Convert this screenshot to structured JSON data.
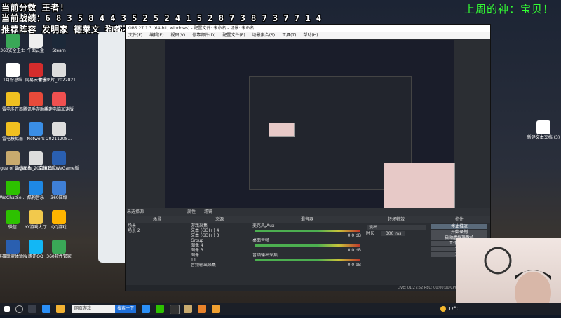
{
  "overlay": {
    "line1": "当前分数 王者!",
    "line2": "当前战绩：6 8 3 5 8 4 4 3 5 2 5 2 4 1 5 2 8 7 3 8 7 3 7 7 1 4",
    "line3": "推荐阵容 发明家 德莱文 狗都不玩男刀 狐狸 德莱文！",
    "god": "上周的神：宝贝！"
  },
  "desktop_icons": [
    {
      "label": "360安全卫士",
      "color": "#3aa757"
    },
    {
      "label": "牛面云盘",
      "color": "#eeeeee"
    },
    {
      "label": "Steam",
      "color": "#1b2838"
    },
    {
      "label": "1月份总结",
      "color": "#ffffff"
    },
    {
      "label": "网易云音乐",
      "color": "#d42c2c"
    },
    {
      "label": "微信图片_2022021...",
      "color": "#dddddd"
    },
    {
      "label": "雷电多开器",
      "color": "#f0c020"
    },
    {
      "label": "腾讯手游助手",
      "color": "#e84a3a"
    },
    {
      "label": "新建电脑加速版",
      "color": "#f05050"
    },
    {
      "label": "雷电模拟器",
      "color": "#f0c020"
    },
    {
      "label": "Network",
      "color": "#3a8ee6"
    },
    {
      "label": "20211208...",
      "color": "#dddddd"
    },
    {
      "label": "League of Legends",
      "color": "#c8aa6e"
    },
    {
      "label": "微信图片_2022021...",
      "color": "#dddddd"
    },
    {
      "label": "英雄联盟WeGame版",
      "color": "#2a5fb0"
    },
    {
      "label": "WeChatSe...",
      "color": "#2dc100"
    },
    {
      "label": "酷狗音乐",
      "color": "#1e88e5"
    },
    {
      "label": "360压缩",
      "color": "#3f7fd6"
    },
    {
      "label": "微信",
      "color": "#2dc100"
    },
    {
      "label": "YY游戏大厅",
      "color": "#f2c94c"
    },
    {
      "label": "QQ游戏",
      "color": "#ffb400"
    },
    {
      "label": "英雄联盟体验服",
      "color": "#2a5fb0"
    },
    {
      "label": "腾讯QQ",
      "color": "#12b7f5"
    },
    {
      "label": "360软件管家",
      "color": "#3aa757"
    }
  ],
  "right_icons": [
    {
      "label": "新建文本文档 (3)",
      "color": "#ffffff"
    }
  ],
  "obs": {
    "title": "OBS 27.1.3 (64-bit, windows) - 配置文件: 未命名 - 场景: 未命名",
    "menu": [
      "文件(F)",
      "编辑(E)",
      "视图(V)",
      "停靠部件(D)",
      "配置文件(P)",
      "场景集合(S)",
      "工具(T)",
      "帮助(H)"
    ],
    "source_hint": "未选择源",
    "props_btn": "属性",
    "filters_btn": "滤镜",
    "docks": {
      "scenes": {
        "title": "场景",
        "items": [
          "场景",
          "场景 2"
        ]
      },
      "sources": {
        "title": "来源",
        "items": [
          "游戏采集",
          "文本 (GDI+) 4",
          "文本 (GDI+) 3",
          "Group",
          "图像 4",
          "图像 3",
          "图像",
          "11",
          "音频输出采集"
        ]
      },
      "mixer": {
        "title": "混音器",
        "channels": [
          "麦克风/Aux",
          "桌面音频",
          "音频输出采集"
        ],
        "levels": [
          "0.0 dB",
          "0.0 dB",
          "0.0 dB"
        ]
      },
      "transitions": {
        "title": "转场特效",
        "type": "淡出",
        "duration_label": "时长",
        "duration": "300 ms"
      },
      "controls": {
        "title": "控件",
        "buttons": [
          "停止推流",
          "开始录制",
          "启动虚拟摄像机",
          "工作室模式",
          "设置",
          "退出"
        ]
      }
    },
    "status": "LIVE: 01:27:52   REC: 00:00:00   CPU: 8.7%, 30.00 fps"
  },
  "taskbar": {
    "search_placeholder": "网页游戏",
    "search_button": "搜索一下",
    "weather": "17°C"
  }
}
